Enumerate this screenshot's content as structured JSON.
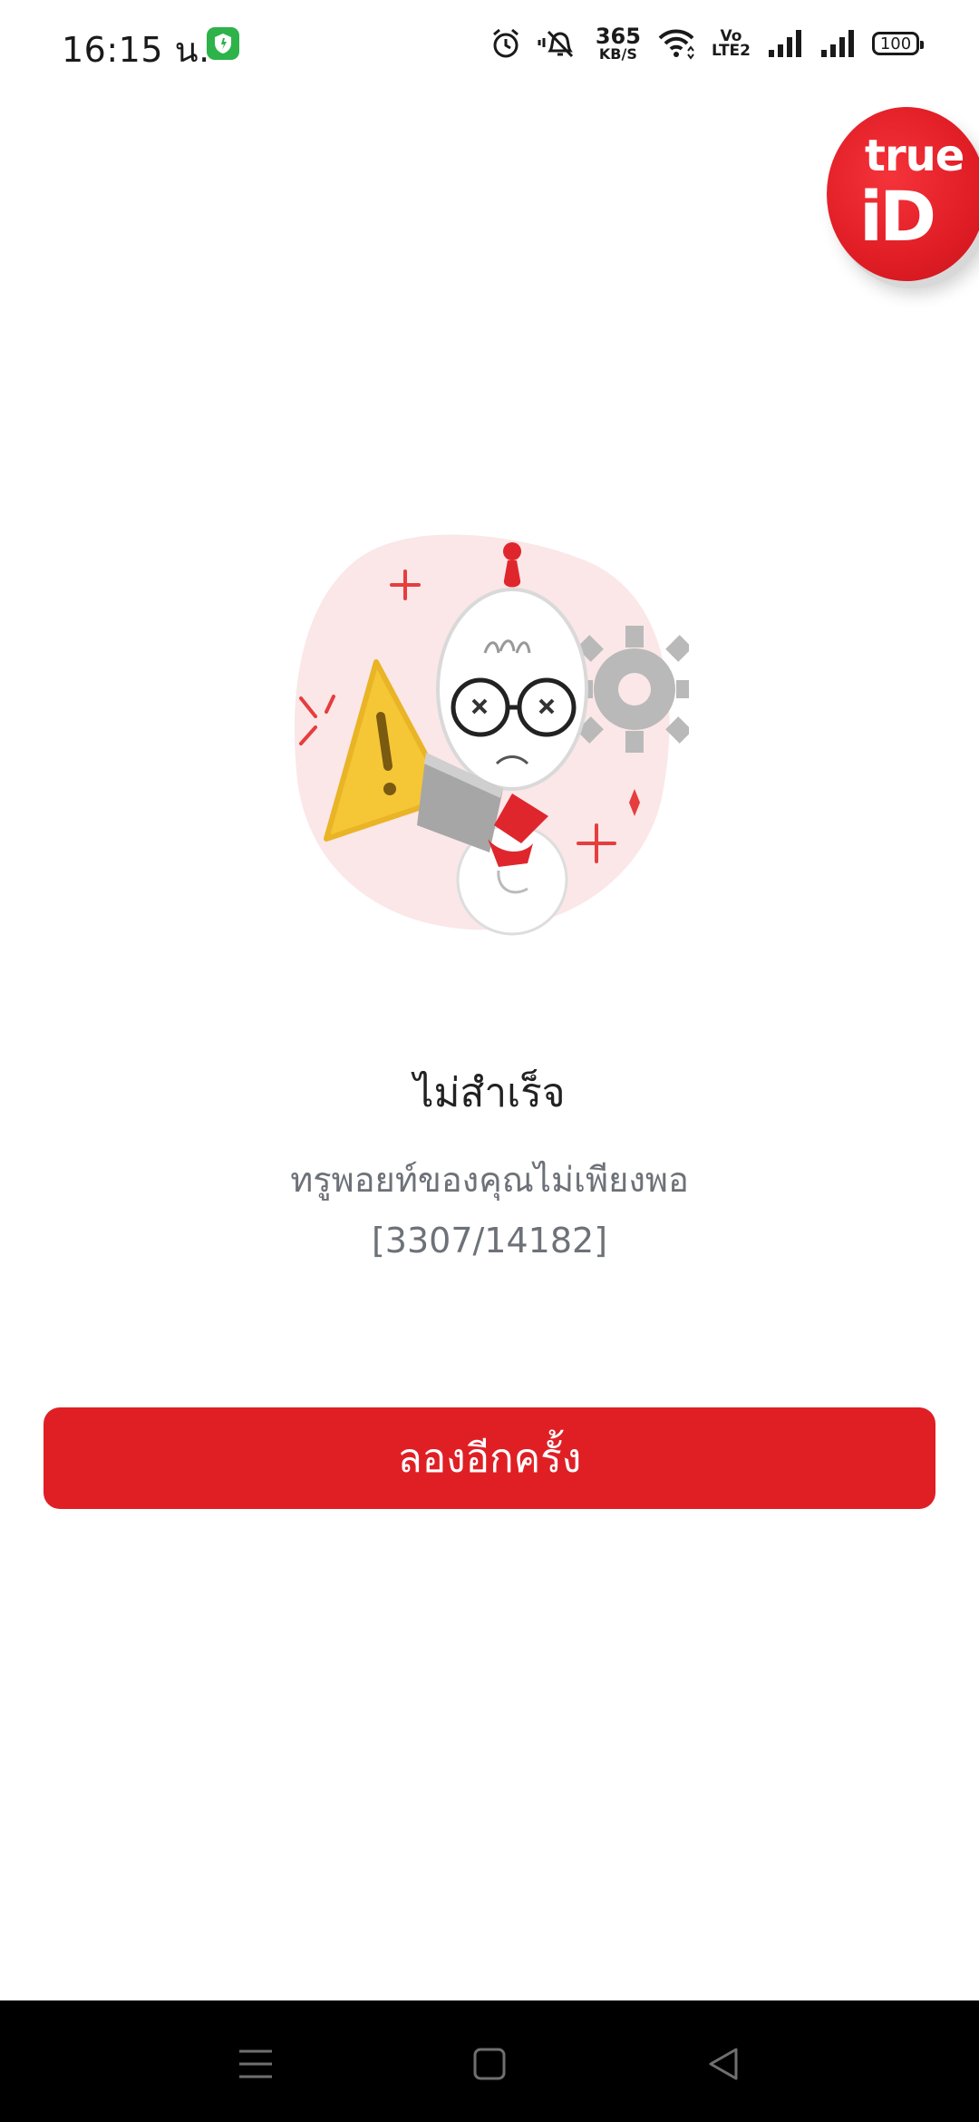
{
  "status_bar": {
    "time": "16:15 น.",
    "net_speed_value": "365",
    "net_speed_unit": "KB/S",
    "volte_top": "Vo",
    "volte_bottom": "LTE2",
    "battery": "100",
    "icons": [
      "shield-app-icon",
      "alarm-icon",
      "muted-bell-icon",
      "wifi-icon",
      "signal-icon",
      "signal-icon"
    ]
  },
  "logo": {
    "line1": "true",
    "line2": "iD"
  },
  "error": {
    "title": "ไม่สำเร็จ",
    "message": "ทรูพอยท์ของคุณไม่เพียงพอ",
    "code": "[3307/14182]"
  },
  "actions": {
    "retry_label": "ลองอีกครั้ง"
  },
  "colors": {
    "accent": "#e01f25",
    "warning": "#f5c636",
    "text_secondary": "#6d7178"
  },
  "nav_bar": {
    "icons": [
      "menu-icon",
      "home-icon",
      "back-icon"
    ]
  }
}
